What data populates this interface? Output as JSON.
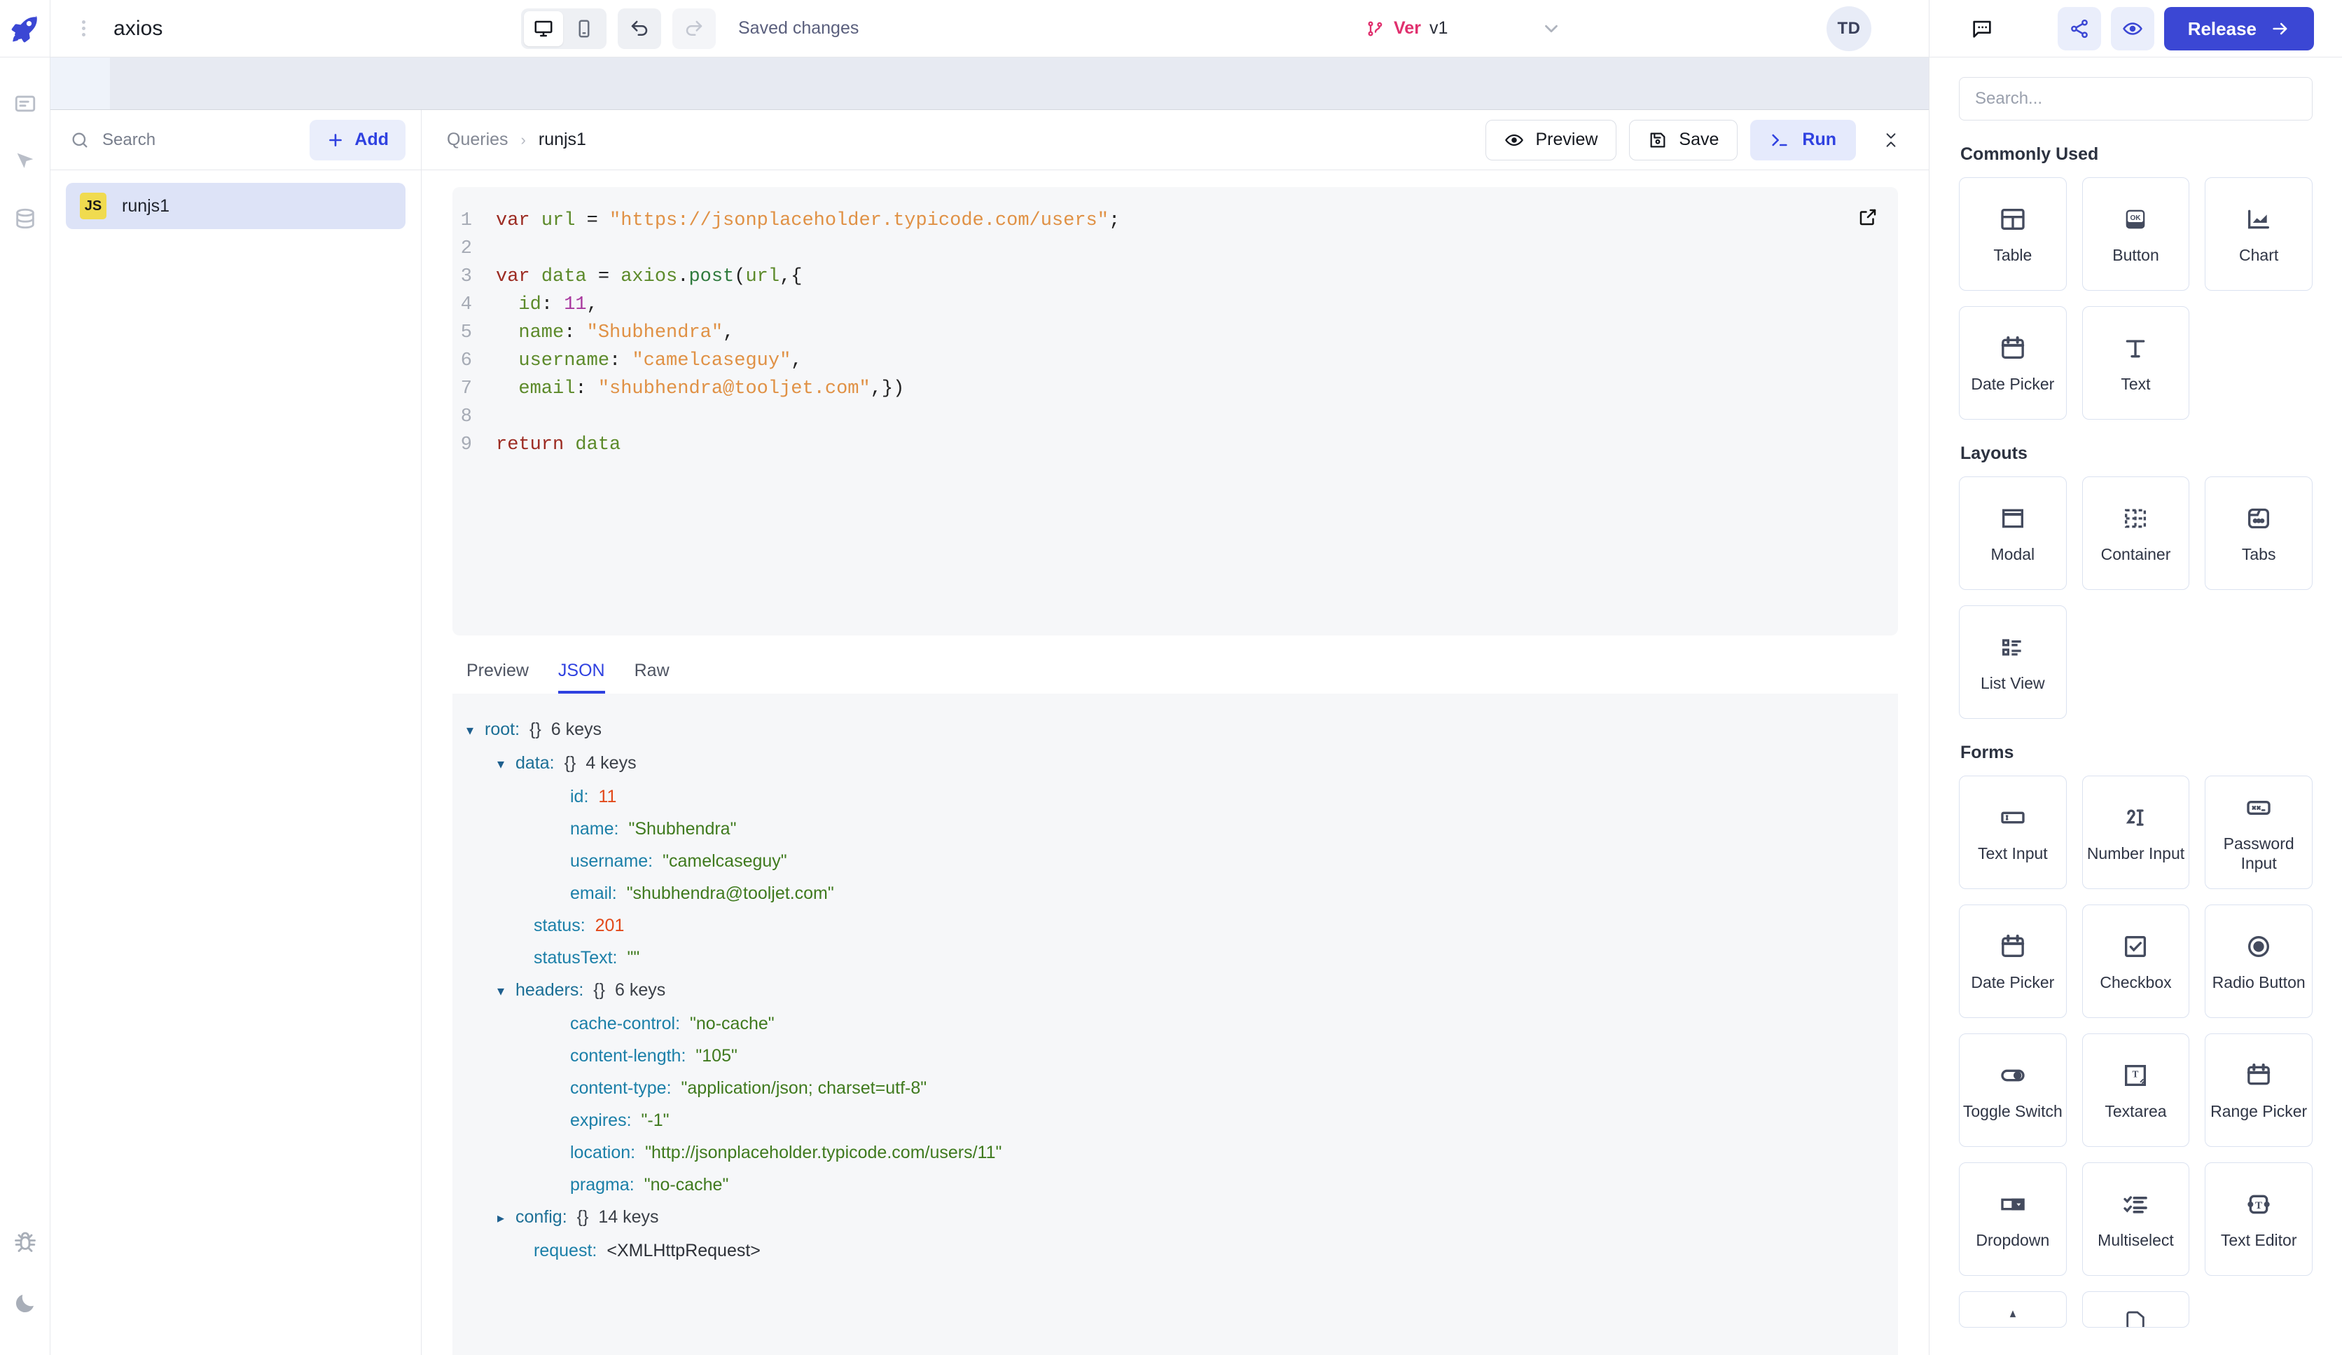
{
  "topbar": {
    "logo_icon": "rocket-icon",
    "drag_handle_icon": "drag-dots-icon",
    "app_title": "axios",
    "device_desktop_icon": "desktop-icon",
    "device_mobile_icon": "mobile-icon",
    "undo_icon": "undo-arrow-icon",
    "redo_icon": "redo-arrow-icon",
    "save_status": "Saved changes",
    "version_icon": "git-branch-icon",
    "version_label": "Ver",
    "version_value": "v1",
    "version_caret_icon": "chevron-down-icon",
    "avatar_initials": "TD",
    "comment_icon": "comment-bubble-icon",
    "share_icon": "share-nodes-icon",
    "preview_eye_icon": "eye-icon",
    "release_label": "Release",
    "release_arrow_icon": "arrow-right-icon",
    "accent_blue": "#3b47d4",
    "accent_pink": "#e0306e"
  },
  "rail": {
    "items": [
      {
        "icon": "pages-document-icon",
        "name": "pages"
      },
      {
        "icon": "cursor-pointer-icon",
        "name": "inspector"
      },
      {
        "icon": "database-icon",
        "name": "data-sources"
      }
    ],
    "bottom": [
      {
        "icon": "bug-icon",
        "name": "debugger"
      },
      {
        "icon": "moon-icon",
        "name": "dark-mode-toggle"
      }
    ]
  },
  "queries_panel": {
    "search_placeholder": "Search",
    "search_value": "",
    "search_icon": "search-icon",
    "add_label": "Add",
    "add_icon": "plus-icon",
    "items": [
      {
        "badge": "JS",
        "label": "runjs1",
        "selected": true
      }
    ]
  },
  "query_editor": {
    "breadcrumb_root": "Queries",
    "breadcrumb_sep": "›",
    "breadcrumb_current": "runjs1",
    "preview_label": "Preview",
    "preview_icon": "eye-icon",
    "save_label": "Save",
    "save_icon": "floppy-disk-icon",
    "run_label": "Run",
    "run_icon": "terminal-prompt-icon",
    "collapse_icon": "collapse-vertical-icon",
    "expand_icon": "external-link-icon",
    "code_lines": [
      {
        "n": 1,
        "text": "var url = \"https://jsonplaceholder.typicode.com/users\";"
      },
      {
        "n": 2,
        "text": ""
      },
      {
        "n": 3,
        "text": "var data = axios.post(url,{"
      },
      {
        "n": 4,
        "text": "  id: 11,"
      },
      {
        "n": 5,
        "text": "  name: \"Shubhendra\","
      },
      {
        "n": 6,
        "text": "  username: \"camelcaseguy\","
      },
      {
        "n": 7,
        "text": "  email: \"shubhendra@tooljet.com\",})"
      },
      {
        "n": 8,
        "text": ""
      },
      {
        "n": 9,
        "text": "return data"
      }
    ]
  },
  "results": {
    "tabs": [
      {
        "label": "Preview",
        "active": false
      },
      {
        "label": "JSON",
        "active": true
      },
      {
        "label": "Raw",
        "active": false
      }
    ],
    "tree": [
      {
        "indent": 0,
        "caret": "▾",
        "key": "root:",
        "node": true,
        "brace": "{}",
        "meta": "6 keys"
      },
      {
        "indent": 1,
        "caret": "▾",
        "key": "data:",
        "node": true,
        "brace": "{}",
        "meta": "4 keys"
      },
      {
        "indent": 2,
        "key": "id:",
        "num": "11"
      },
      {
        "indent": 2,
        "key": "name:",
        "str": "\"Shubhendra\""
      },
      {
        "indent": 2,
        "key": "username:",
        "str": "\"camelcaseguy\""
      },
      {
        "indent": 2,
        "key": "email:",
        "str": "\"shubhendra@tooljet.com\""
      },
      {
        "indent": 1,
        "key": "status:",
        "num": "201"
      },
      {
        "indent": 1,
        "key": "statusText:",
        "str": "\"\""
      },
      {
        "indent": 1,
        "caret": "▾",
        "key": "headers:",
        "node": true,
        "brace": "{}",
        "meta": "6 keys"
      },
      {
        "indent": 2,
        "key": "cache-control:",
        "str": "\"no-cache\""
      },
      {
        "indent": 2,
        "key": "content-length:",
        "str": "\"105\""
      },
      {
        "indent": 2,
        "key": "content-type:",
        "str": "\"application/json; charset=utf-8\""
      },
      {
        "indent": 2,
        "key": "expires:",
        "str": "\"-1\""
      },
      {
        "indent": 2,
        "key": "location:",
        "str": "\"http://jsonplaceholder.typicode.com/users/11\""
      },
      {
        "indent": 2,
        "key": "pragma:",
        "str": "\"no-cache\""
      },
      {
        "indent": 1,
        "caret": "▸",
        "key": "config:",
        "node": true,
        "brace": "{}",
        "meta": "14 keys"
      },
      {
        "indent": 1,
        "key": "request:",
        "plain": "<XMLHttpRequest>"
      }
    ]
  },
  "right_panel": {
    "search_placeholder": "Search...",
    "search_value": "",
    "sections": [
      {
        "title": "Commonly Used",
        "items": [
          {
            "label": "Table",
            "icon": "table-grid-icon"
          },
          {
            "label": "Button",
            "icon": "ok-button-icon"
          },
          {
            "label": "Chart",
            "icon": "chart-bars-icon"
          },
          {
            "label": "Date Picker",
            "icon": "calendar-icon"
          },
          {
            "label": "Text",
            "icon": "text-t-icon"
          }
        ]
      },
      {
        "title": "Layouts",
        "items": [
          {
            "label": "Modal",
            "icon": "window-modal-icon"
          },
          {
            "label": "Container",
            "icon": "dashed-container-icon"
          },
          {
            "label": "Tabs",
            "icon": "tabs-icon"
          },
          {
            "label": "List View",
            "icon": "list-view-icon"
          }
        ]
      },
      {
        "title": "Forms",
        "items": [
          {
            "label": "Text Input",
            "icon": "text-input-icon"
          },
          {
            "label": "Number Input",
            "icon": "number-input-icon"
          },
          {
            "label": "Password Input",
            "icon": "password-input-icon"
          },
          {
            "label": "Date Picker",
            "icon": "calendar-icon"
          },
          {
            "label": "Checkbox",
            "icon": "checkbox-icon"
          },
          {
            "label": "Radio Button",
            "icon": "radio-button-icon"
          },
          {
            "label": "Toggle Switch",
            "icon": "toggle-switch-icon"
          },
          {
            "label": "Textarea",
            "icon": "textarea-icon"
          },
          {
            "label": "Range Picker",
            "icon": "range-picker-icon"
          },
          {
            "label": "Dropdown",
            "icon": "dropdown-icon"
          },
          {
            "label": "Multiselect",
            "icon": "multiselect-icon"
          },
          {
            "label": "Text Editor",
            "icon": "text-editor-icon"
          },
          {
            "label": "",
            "icon": "partial-icon-a"
          },
          {
            "label": "",
            "icon": "partial-icon-b"
          }
        ]
      }
    ]
  }
}
